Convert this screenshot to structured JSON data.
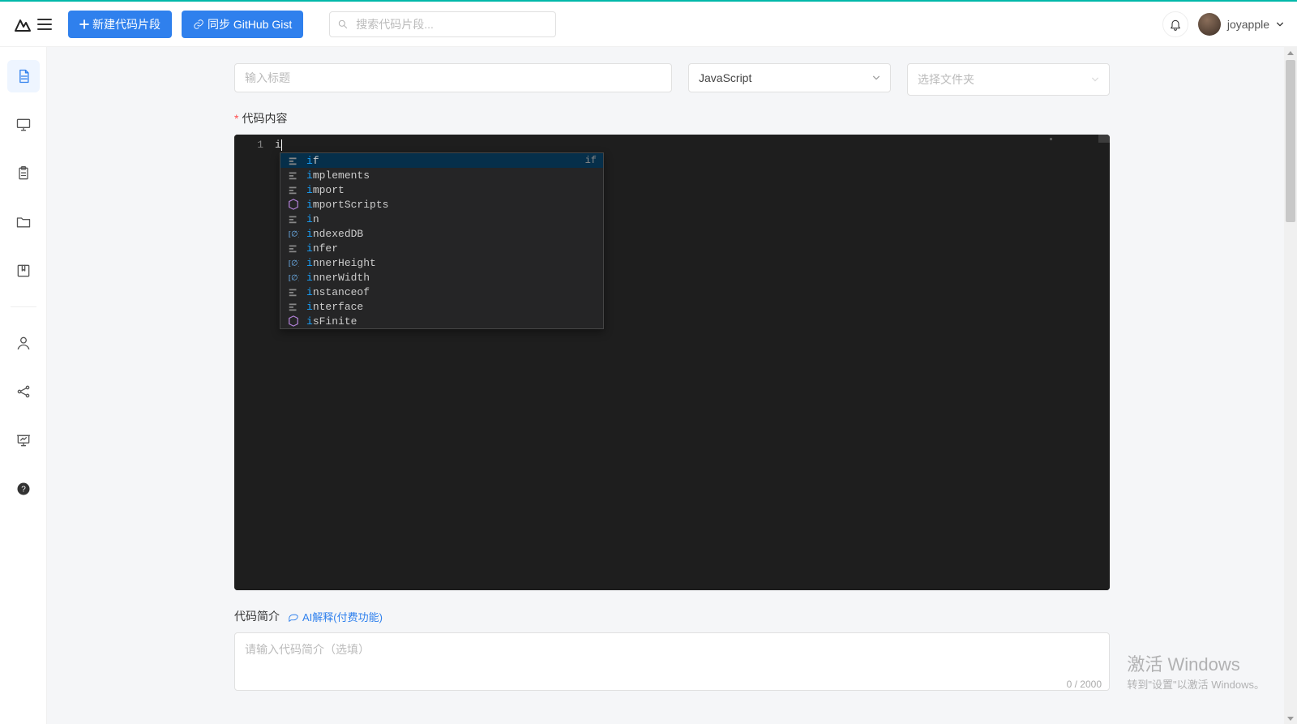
{
  "header": {
    "new_button": "新建代码片段",
    "sync_button": "同步 GitHub Gist",
    "search_placeholder": "搜索代码片段...",
    "username": "joyapple"
  },
  "form": {
    "title_placeholder": "输入标题",
    "language_value": "JavaScript",
    "folder_placeholder": "选择文件夹",
    "code_label": "代码内容",
    "desc_label": "代码简介",
    "ai_link": "AI解释(付费功能)",
    "desc_placeholder": "请输入代码简介（选填）",
    "char_counter": "0 / 2000"
  },
  "editor": {
    "line_number": "1",
    "typed": "i",
    "suggestions": [
      {
        "kind": "keyword",
        "text": "if",
        "detail": "if"
      },
      {
        "kind": "keyword",
        "text": "implements",
        "detail": ""
      },
      {
        "kind": "keyword",
        "text": "import",
        "detail": ""
      },
      {
        "kind": "module",
        "text": "importScripts",
        "detail": ""
      },
      {
        "kind": "keyword",
        "text": "in",
        "detail": ""
      },
      {
        "kind": "variable",
        "text": "indexedDB",
        "detail": ""
      },
      {
        "kind": "keyword",
        "text": "infer",
        "detail": ""
      },
      {
        "kind": "variable",
        "text": "innerHeight",
        "detail": ""
      },
      {
        "kind": "variable",
        "text": "innerWidth",
        "detail": ""
      },
      {
        "kind": "keyword",
        "text": "instanceof",
        "detail": ""
      },
      {
        "kind": "keyword",
        "text": "interface",
        "detail": ""
      },
      {
        "kind": "module",
        "text": "isFinite",
        "detail": ""
      }
    ]
  },
  "watermark": {
    "line1": "激活 Windows",
    "line2": "转到\"设置\"以激活 Windows。"
  }
}
